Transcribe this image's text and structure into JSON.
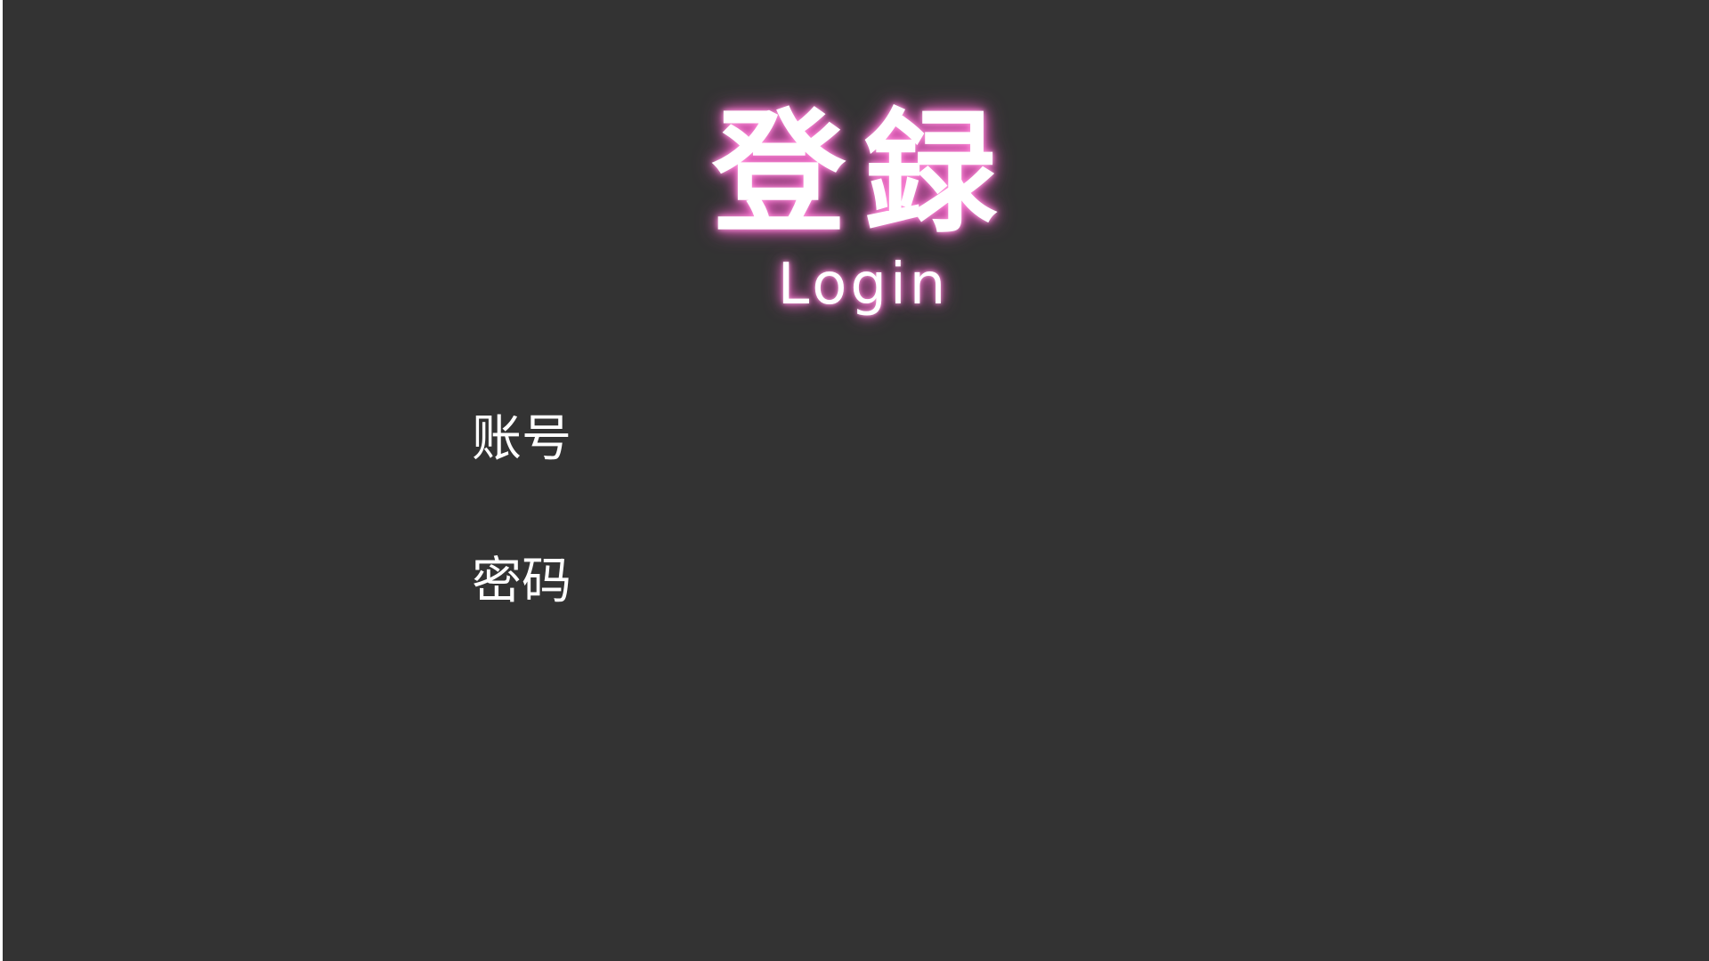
{
  "colors": {
    "background": "#333333",
    "text": "#ffffff",
    "glow": "#ff6ccf",
    "left_edge": "#ffffff"
  },
  "login": {
    "title_cn": "登録",
    "title_en": "Login",
    "account_label": "账号",
    "password_label": "密码"
  }
}
